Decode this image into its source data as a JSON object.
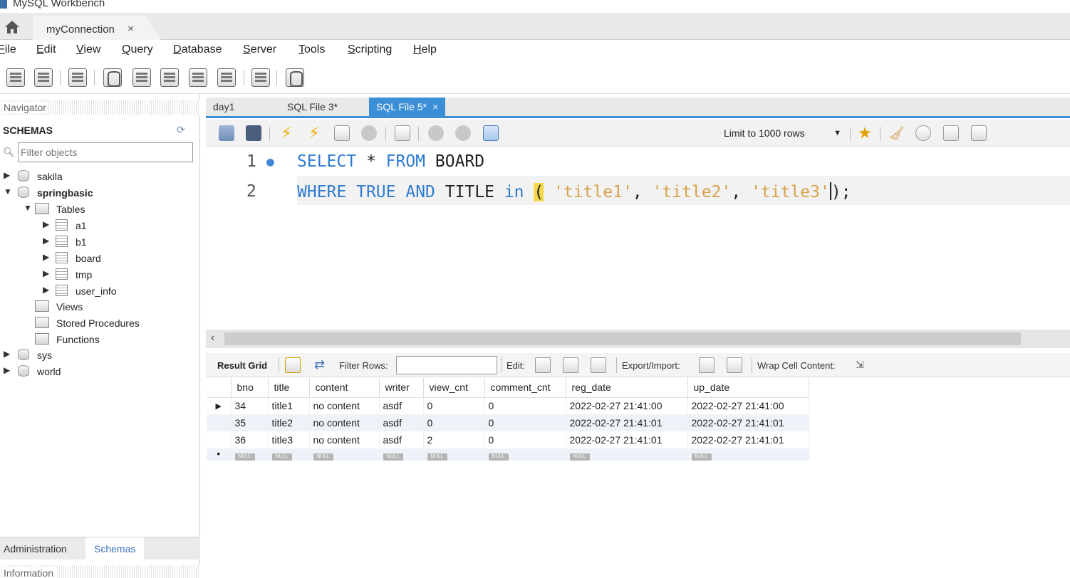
{
  "window": {
    "title": "MySQL Workbench"
  },
  "connection_tab": {
    "label": "myConnection",
    "close": "×"
  },
  "menu": {
    "items": [
      {
        "first": "F",
        "rest": "ile"
      },
      {
        "first": "E",
        "rest": "dit"
      },
      {
        "first": "V",
        "rest": "iew"
      },
      {
        "first": "Q",
        "rest": "uery"
      },
      {
        "first": "D",
        "rest": "atabase"
      },
      {
        "first": "S",
        "rest": "erver"
      },
      {
        "first": "T",
        "rest": "ools"
      },
      {
        "first": "S",
        "rest": "cripting"
      },
      {
        "first": "H",
        "rest": "elp"
      }
    ]
  },
  "navigator": {
    "header": "Navigator",
    "schemas_label": "SCHEMAS",
    "filter_placeholder": "Filter objects",
    "tree": {
      "sakila": "sakila",
      "springbasic": "springbasic",
      "tables": "Tables",
      "table_items": [
        "a1",
        "b1",
        "board",
        "tmp",
        "user_info"
      ],
      "views": "Views",
      "procedures": "Stored Procedures",
      "functions": "Functions",
      "sys": "sys",
      "world": "world"
    },
    "bottom_tabs": {
      "administration": "Administration",
      "schemas": "Schemas"
    },
    "information_header": "Information"
  },
  "editor": {
    "tabs": {
      "day1": "day1",
      "file3": "SQL File 3*",
      "file5": "SQL File 5*",
      "close": "×"
    },
    "limit_select": "Limit to 1000 rows",
    "lines": {
      "n1": "1",
      "n2": "2",
      "l1_kw1": "SELECT",
      "l1_star": " * ",
      "l1_kw2": "FROM",
      "l1_tbl": " BOARD",
      "l2_kw1": "WHERE",
      "l2_kw2": " TRUE ",
      "l2_kw3": "AND",
      "l2_col": " TITLE ",
      "l2_kw4": "in",
      "l2_paren_open": "(",
      "l2_s1": " 'title1'",
      "l2_c1": ", ",
      "l2_s2": "'title2'",
      "l2_c2": ", ",
      "l2_s3": "'title3'",
      "l2_end": ");"
    }
  },
  "result": {
    "toolbar": {
      "result_grid": "Result Grid",
      "filter_rows": "Filter Rows:",
      "edit": "Edit:",
      "export_import": "Export/Import:",
      "wrap": "Wrap Cell Content:"
    },
    "columns": [
      "bno",
      "title",
      "content",
      "writer",
      "view_cnt",
      "comment_cnt",
      "reg_date",
      "up_date"
    ],
    "rows": [
      [
        "34",
        "title1",
        "no content",
        "asdf",
        "0",
        "0",
        "2022-02-27 21:41:00",
        "2022-02-27 21:41:00"
      ],
      [
        "35",
        "title2",
        "no content",
        "asdf",
        "0",
        "0",
        "2022-02-27 21:41:01",
        "2022-02-27 21:41:01"
      ],
      [
        "36",
        "title3",
        "no content",
        "asdf",
        "2",
        "0",
        "2022-02-27 21:41:01",
        "2022-02-27 21:41:01"
      ]
    ],
    "null_label": "NULL",
    "current_row_marker": "▶",
    "new_row_marker": "•"
  }
}
